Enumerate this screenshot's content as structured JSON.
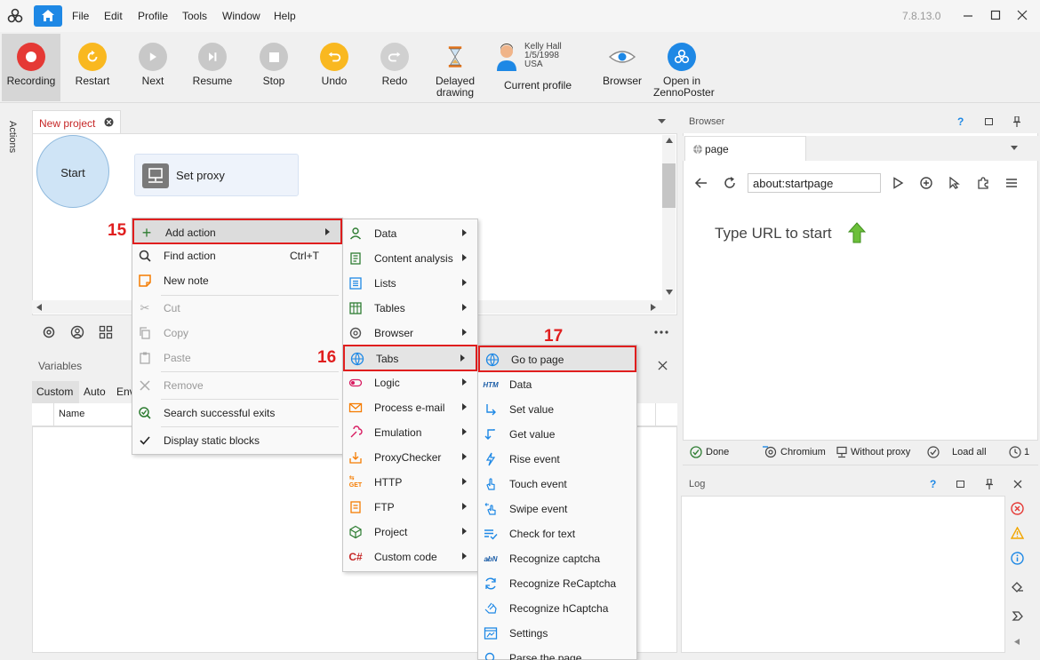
{
  "menubar": {
    "items": [
      "File",
      "Edit",
      "Profile",
      "Tools",
      "Window",
      "Help"
    ],
    "version": "7.8.13.0"
  },
  "toolbar": {
    "recording": "Recording",
    "restart": "Restart",
    "next": "Next",
    "resume": "Resume",
    "stop": "Stop",
    "undo": "Undo",
    "redo": "Redo",
    "delayed_drawing_1": "Delayed",
    "delayed_drawing_2": "drawing",
    "current_profile": "Current profile",
    "browser": "Browser",
    "open_in_1": "Open in",
    "open_in_2": "ZennoPoster"
  },
  "profile": {
    "name": "Kelly Hall",
    "dob": "1/5/1998",
    "country": "USA"
  },
  "left_strip": {
    "label": "Actions"
  },
  "project": {
    "tab_label": "New project",
    "start_label": "Start",
    "proxy_label": "Set proxy"
  },
  "variables": {
    "title": "Variables",
    "tabs": [
      "Custom",
      "Auto",
      "Env"
    ],
    "col_name": "Name"
  },
  "browser": {
    "title": "Browser",
    "tab_label": "page",
    "url": "about:startpage",
    "hint": "Type URL to start",
    "status": {
      "done": "Done",
      "engine": "Chromium",
      "proxy": "Without proxy",
      "load": "Load all",
      "timer": "1"
    }
  },
  "log": {
    "title": "Log"
  },
  "menu1": {
    "add_action": "Add action",
    "find_action": "Find action",
    "find_shortcut": "Ctrl+T",
    "new_note": "New note",
    "cut": "Cut",
    "copy": "Copy",
    "paste": "Paste",
    "remove": "Remove",
    "search_exits": "Search successful exits",
    "static_blocks": "Display static blocks"
  },
  "menu2": {
    "items": [
      "Data",
      "Content analysis",
      "Lists",
      "Tables",
      "Browser",
      "Tabs",
      "Logic",
      "Process e-mail",
      "Emulation",
      "ProxyChecker",
      "HTTP",
      "FTP",
      "Project",
      "Custom code"
    ]
  },
  "menu3": {
    "items": [
      "Go to page",
      "Data",
      "Set value",
      "Get value",
      "Rise event",
      "Touch event",
      "Swipe event",
      "Check for text",
      "Recognize captcha",
      "Recognize ReCaptcha",
      "Recognize hCaptcha",
      "Settings",
      "Parse the page"
    ]
  },
  "annotations": {
    "a15": "15",
    "a16": "16",
    "a17": "17"
  },
  "colors": {
    "accent_blue": "#1e88e5",
    "record_red": "#e53935",
    "highlight_red": "#e01e1e",
    "undo_yellow": "#f9b820"
  }
}
